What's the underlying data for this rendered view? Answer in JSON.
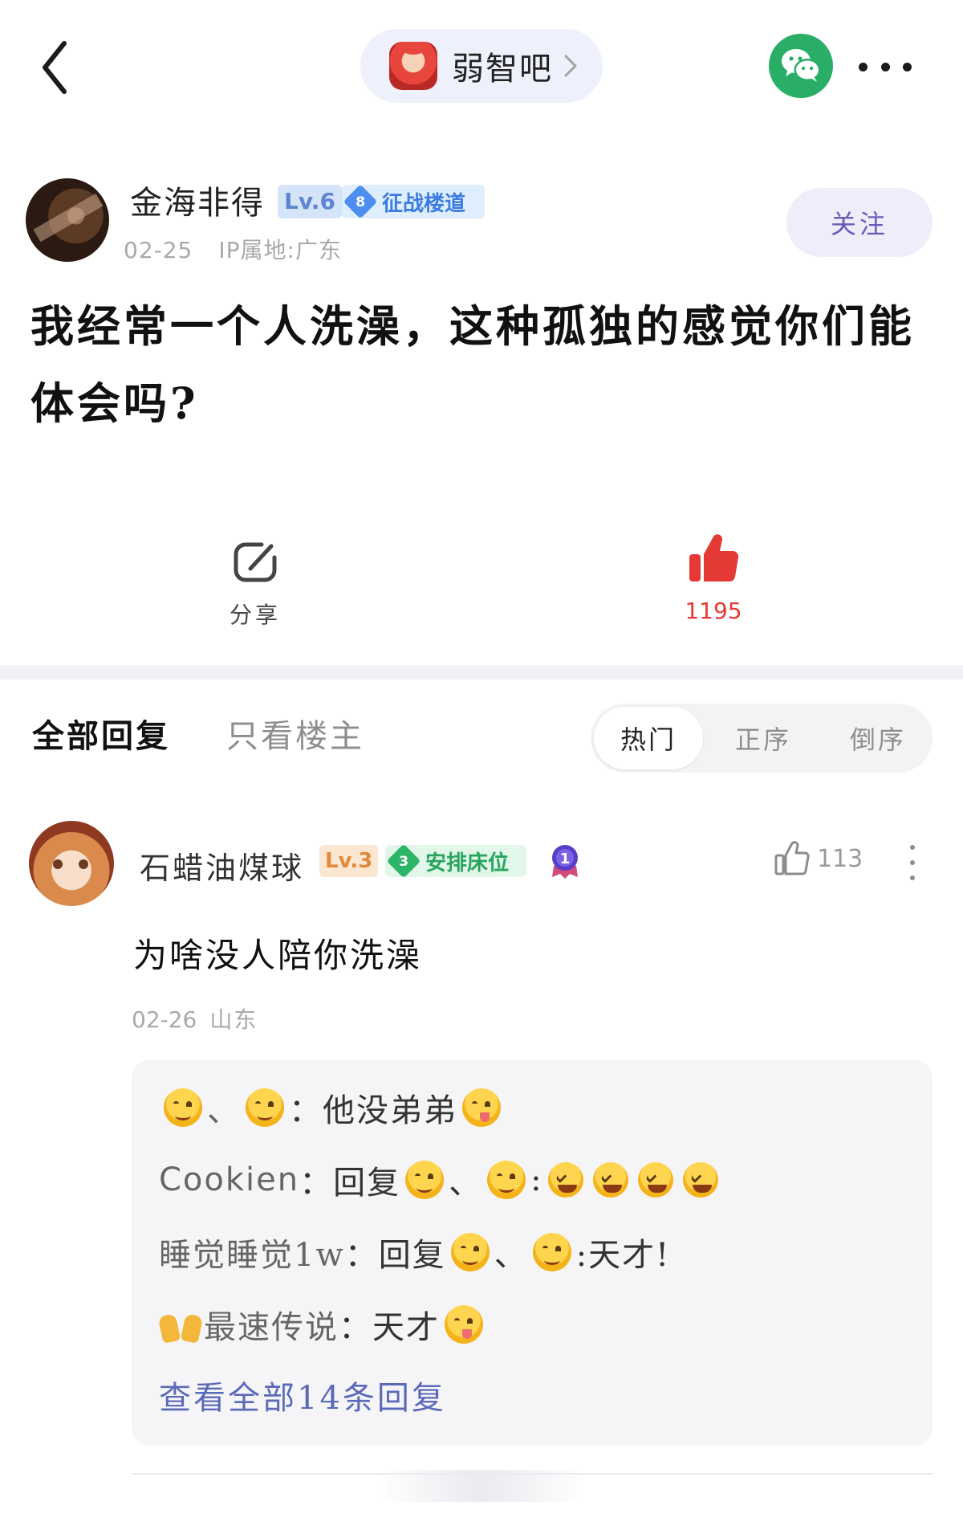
{
  "header": {
    "forum_name": "弱智吧"
  },
  "post": {
    "author": {
      "name": "金海非得",
      "level": "Lv.6",
      "rank_number": "8",
      "rank_title": "征战楼道",
      "date": "02-25",
      "ip_location": "IP属地:广东"
    },
    "follow_label": "关注",
    "title": "我经常一个人洗澡，这种孤独的感觉你们能体会吗?",
    "share_label": "分享",
    "like_count": "1195"
  },
  "tabs": {
    "all_replies": "全部回复",
    "op_only": "只看楼主",
    "sort_options": [
      "热门",
      "正序",
      "倒序"
    ],
    "active_sort": "热门"
  },
  "comment": {
    "author": {
      "name": "石蜡油煤球",
      "level": "Lv.3",
      "rank_number": "3",
      "rank_title": "安排床位",
      "medal_number": "1"
    },
    "like_count": "113",
    "text": "为啥没人陪你洗澡",
    "date": "02-26",
    "location": "山东",
    "replies": [
      {
        "user_sep": "、",
        "colon": "：",
        "text": "他没弟弟"
      },
      {
        "user": "Cookien",
        "colon": "：",
        "reply_word": "回复",
        "sep": "、",
        "colon2": ":"
      },
      {
        "user": "睡觉睡觉1w",
        "colon": "：",
        "reply_word": "回复",
        "sep": "、",
        "text": ":天才!"
      },
      {
        "user": "最速传说",
        "colon": "：",
        "text": "天才"
      }
    ],
    "view_all_label": "查看全部14条回复"
  },
  "colors": {
    "accent_like": "#e53935",
    "accent_purple": "#6b5bb8",
    "wechat_green": "#2aae67",
    "link_blue": "#5b6ab8"
  },
  "icons": {
    "back": "back-chevron-icon",
    "wechat": "wechat-icon",
    "more": "more-dots-icon",
    "share": "share-icon",
    "like": "thumbs-up-filled-icon",
    "comment_like": "thumbs-up-outline-icon",
    "emoji": "smiling-face-icon",
    "grin": "grinning-squint-face-icon",
    "hands": "raising-hands-icon"
  }
}
